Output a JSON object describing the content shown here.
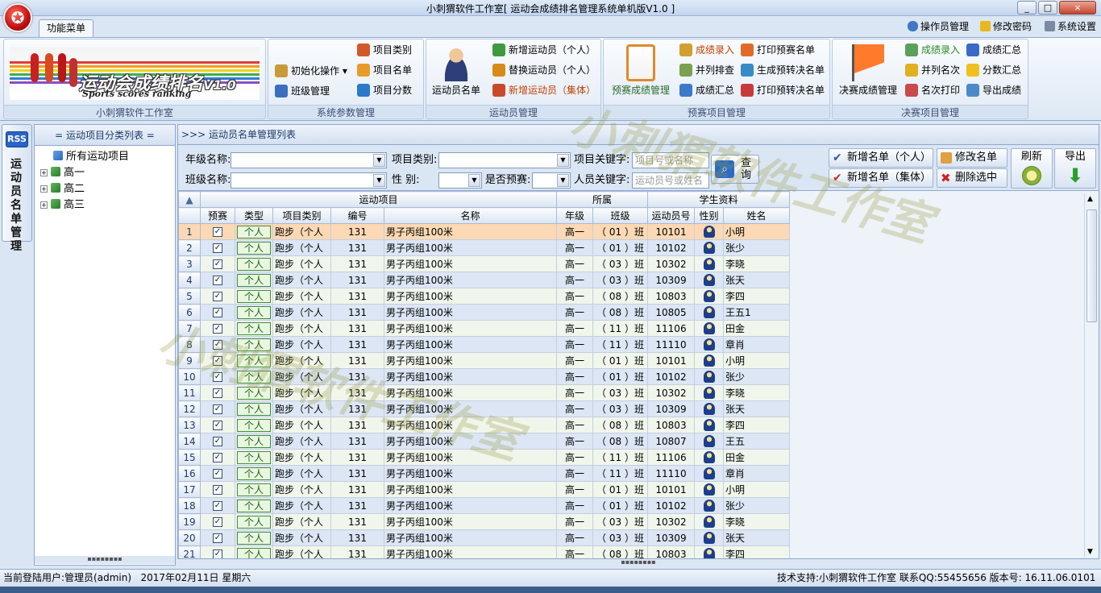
{
  "window": {
    "title": "小刺猬软件工作室[ 运动会成绩排名管理系统单机版V1.0 ]",
    "min": "_",
    "max": "□",
    "close": "×"
  },
  "ribbon_tab": "功能菜单",
  "top_links": {
    "operator": "操作员管理",
    "password": "修改密码",
    "settings": "系统设置"
  },
  "logo": {
    "title": "运动会成绩排名",
    "subtitle": "Sports scores ranking",
    "version": "V1.0"
  },
  "groups": {
    "studio": {
      "name": "小刺猬软件工作室"
    },
    "system": {
      "name": "系统参数管理",
      "init": "初始化操作",
      "class_mgmt": "班级管理",
      "item_category": "项目类别",
      "item_list": "项目名单",
      "item_score": "项目分数"
    },
    "athlete": {
      "name": "运动员管理",
      "big": "运动员名单",
      "add_individual": "新增运动员（个人）",
      "replace_individual": "替换运动员（个人）",
      "add_team": "新增运动员（集体）"
    },
    "prelim": {
      "name": "预赛项目管理",
      "big": "预赛成绩管理",
      "score_entry": "成绩录入",
      "tie_check": "并列排查",
      "score_summary": "成绩汇总",
      "print_list": "打印预赛名单",
      "gen_final": "生成预转决名单",
      "print_final": "打印预转决名单"
    },
    "final": {
      "name": "决赛项目管理",
      "big": "决赛成绩管理",
      "score_entry": "成绩录入",
      "tie_rank": "并列名次",
      "rank_print": "名次打印",
      "score_summary": "成绩汇总",
      "points_summary": "分数汇总",
      "export": "导出成绩"
    }
  },
  "sidebar": {
    "rss": "RSS",
    "vertical_label": "运动员名单管理"
  },
  "tree": {
    "title": "= 运动项目分类列表 =",
    "root": "所有运动项目",
    "nodes": [
      "高一",
      "高二",
      "高三"
    ],
    "split": "▪▪▪▪▪▪▪▪"
  },
  "main": {
    "title": ">>> 运动员名单管理列表"
  },
  "filter": {
    "grade_label": "年级名称:",
    "category_label": "项目类别:",
    "keyword_label": "项目关键字:",
    "keyword_placeholder": "项目号或名称",
    "class_label": "班级名称:",
    "gender_label": "性    别:",
    "prelim_label": "是否预赛:",
    "person_label": "人员关键字:",
    "person_placeholder": "运动员号或姓名",
    "query_label": "查询"
  },
  "actions": {
    "add_individual": "新增名单（个人）",
    "add_team": "新增名单（集体）",
    "edit": "修改名单",
    "delete": "删除选中",
    "refresh": "刷新",
    "export": "导出"
  },
  "grid": {
    "group_headers": {
      "event": "运动项目",
      "belong": "所属",
      "student": "学生资料"
    },
    "columns": [
      "预赛",
      "类型",
      "项目类别",
      "编号",
      "名称",
      "年级",
      "班级",
      "运动员号",
      "性别",
      "姓名"
    ],
    "rows": [
      {
        "n": "1",
        "type": "个人",
        "cat": "跑步（个人",
        "no": "131",
        "name": "男子丙组100米",
        "grade": "高一",
        "cls": "（ 01 ）班",
        "aid": "10101",
        "sname": "小明"
      },
      {
        "n": "2",
        "type": "个人",
        "cat": "跑步（个人",
        "no": "131",
        "name": "男子丙组100米",
        "grade": "高一",
        "cls": "（ 01 ）班",
        "aid": "10102",
        "sname": "张少"
      },
      {
        "n": "3",
        "type": "个人",
        "cat": "跑步（个人",
        "no": "131",
        "name": "男子丙组100米",
        "grade": "高一",
        "cls": "（ 03 ）班",
        "aid": "10302",
        "sname": "李晓"
      },
      {
        "n": "4",
        "type": "个人",
        "cat": "跑步（个人",
        "no": "131",
        "name": "男子丙组100米",
        "grade": "高一",
        "cls": "（ 03 ）班",
        "aid": "10309",
        "sname": "张天"
      },
      {
        "n": "5",
        "type": "个人",
        "cat": "跑步（个人",
        "no": "131",
        "name": "男子丙组100米",
        "grade": "高一",
        "cls": "（ 08 ）班",
        "aid": "10803",
        "sname": "李四"
      },
      {
        "n": "6",
        "type": "个人",
        "cat": "跑步（个人",
        "no": "131",
        "name": "男子丙组100米",
        "grade": "高一",
        "cls": "（ 08 ）班",
        "aid": "10805",
        "sname": "王五1"
      },
      {
        "n": "7",
        "type": "个人",
        "cat": "跑步（个人",
        "no": "131",
        "name": "男子丙组100米",
        "grade": "高一",
        "cls": "（ 11 ）班",
        "aid": "11106",
        "sname": "田金"
      },
      {
        "n": "8",
        "type": "个人",
        "cat": "跑步（个人",
        "no": "131",
        "name": "男子丙组100米",
        "grade": "高一",
        "cls": "（ 11 ）班",
        "aid": "11110",
        "sname": "章肖"
      },
      {
        "n": "9",
        "type": "个人",
        "cat": "跑步（个人",
        "no": "131",
        "name": "男子丙组100米",
        "grade": "高一",
        "cls": "（ 01 ）班",
        "aid": "10101",
        "sname": "小明"
      },
      {
        "n": "10",
        "type": "个人",
        "cat": "跑步（个人",
        "no": "131",
        "name": "男子丙组100米",
        "grade": "高一",
        "cls": "（ 01 ）班",
        "aid": "10102",
        "sname": "张少"
      },
      {
        "n": "11",
        "type": "个人",
        "cat": "跑步（个人",
        "no": "131",
        "name": "男子丙组100米",
        "grade": "高一",
        "cls": "（ 03 ）班",
        "aid": "10302",
        "sname": "李晓"
      },
      {
        "n": "12",
        "type": "个人",
        "cat": "跑步（个人",
        "no": "131",
        "name": "男子丙组100米",
        "grade": "高一",
        "cls": "（ 03 ）班",
        "aid": "10309",
        "sname": "张天"
      },
      {
        "n": "13",
        "type": "个人",
        "cat": "跑步（个人",
        "no": "131",
        "name": "男子丙组100米",
        "grade": "高一",
        "cls": "（ 08 ）班",
        "aid": "10803",
        "sname": "李四"
      },
      {
        "n": "14",
        "type": "个人",
        "cat": "跑步（个人",
        "no": "131",
        "name": "男子丙组100米",
        "grade": "高一",
        "cls": "（ 08 ）班",
        "aid": "10807",
        "sname": "王五"
      },
      {
        "n": "15",
        "type": "个人",
        "cat": "跑步（个人",
        "no": "131",
        "name": "男子丙组100米",
        "grade": "高一",
        "cls": "（ 11 ）班",
        "aid": "11106",
        "sname": "田金"
      },
      {
        "n": "16",
        "type": "个人",
        "cat": "跑步（个人",
        "no": "131",
        "name": "男子丙组100米",
        "grade": "高一",
        "cls": "（ 11 ）班",
        "aid": "11110",
        "sname": "章肖"
      },
      {
        "n": "17",
        "type": "个人",
        "cat": "跑步（个人",
        "no": "131",
        "name": "男子丙组100米",
        "grade": "高一",
        "cls": "（ 01 ）班",
        "aid": "10101",
        "sname": "小明"
      },
      {
        "n": "18",
        "type": "个人",
        "cat": "跑步（个人",
        "no": "131",
        "name": "男子丙组100米",
        "grade": "高一",
        "cls": "（ 01 ）班",
        "aid": "10102",
        "sname": "张少"
      },
      {
        "n": "19",
        "type": "个人",
        "cat": "跑步（个人",
        "no": "131",
        "name": "男子丙组100米",
        "grade": "高一",
        "cls": "（ 03 ）班",
        "aid": "10302",
        "sname": "李晓"
      },
      {
        "n": "20",
        "type": "个人",
        "cat": "跑步（个人",
        "no": "131",
        "name": "男子丙组100米",
        "grade": "高一",
        "cls": "（ 03 ）班",
        "aid": "10309",
        "sname": "张天"
      },
      {
        "n": "21",
        "type": "个人",
        "cat": "跑步（个人",
        "no": "131",
        "name": "男子丙组100米",
        "grade": "高一",
        "cls": "（ 08 ）班",
        "aid": "10803",
        "sname": "李四"
      }
    ]
  },
  "status": {
    "left": "当前登陆用户:管理员(admin)   2017年02月11日 星期六",
    "right": "技术支持:小刺猬软件工作室 联系QQ:55455656 版本号: 16.11.06.0101"
  },
  "watermark": "小刺猬软件工作室",
  "colors": {
    "selected_row": "#fcd9b4",
    "odd_row": "#f1f6ec",
    "even_row": "#dce6f4",
    "header_text": "#1d3a6a"
  }
}
